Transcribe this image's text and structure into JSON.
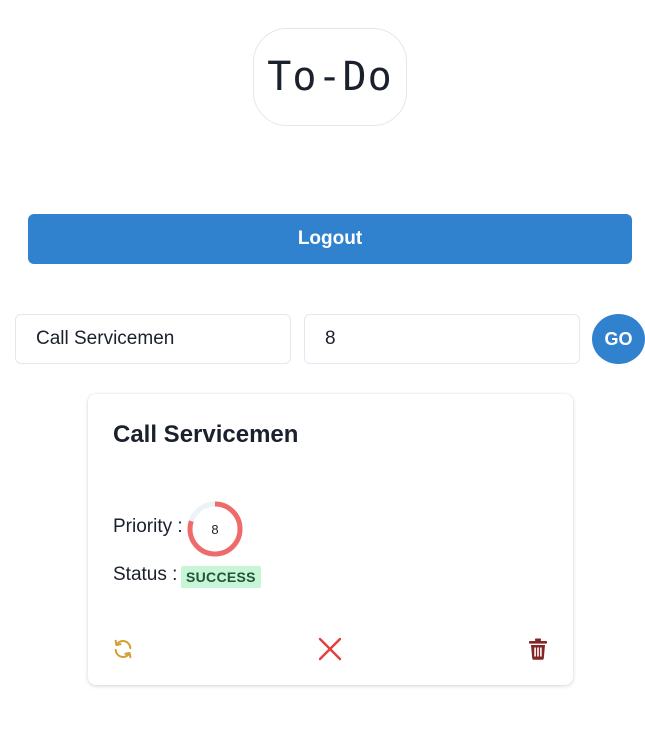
{
  "header": {
    "logo_text": "To-Do"
  },
  "toolbar": {
    "logout_label": "Logout"
  },
  "form": {
    "task_value": "Call Servicemen",
    "priority_value": "8",
    "go_label": "GO"
  },
  "task_card": {
    "title": "Call Servicemen",
    "priority_label": "Priority :",
    "priority_value": "8",
    "priority_fraction": 0.8,
    "status_label": "Status :",
    "status_badge": "SUCCESS"
  },
  "colors": {
    "primary": "#3182ce",
    "ring": "#ef6b6b",
    "ring_track": "#edf2f7",
    "success_bg": "#c6f6d5",
    "success_text": "#22543d",
    "refresh_icon": "#d69e2e",
    "close_icon": "#e53e3e",
    "trash_icon": "#822727"
  },
  "icons": {
    "refresh": "refresh-icon",
    "close": "close-icon",
    "trash": "trash-icon"
  }
}
